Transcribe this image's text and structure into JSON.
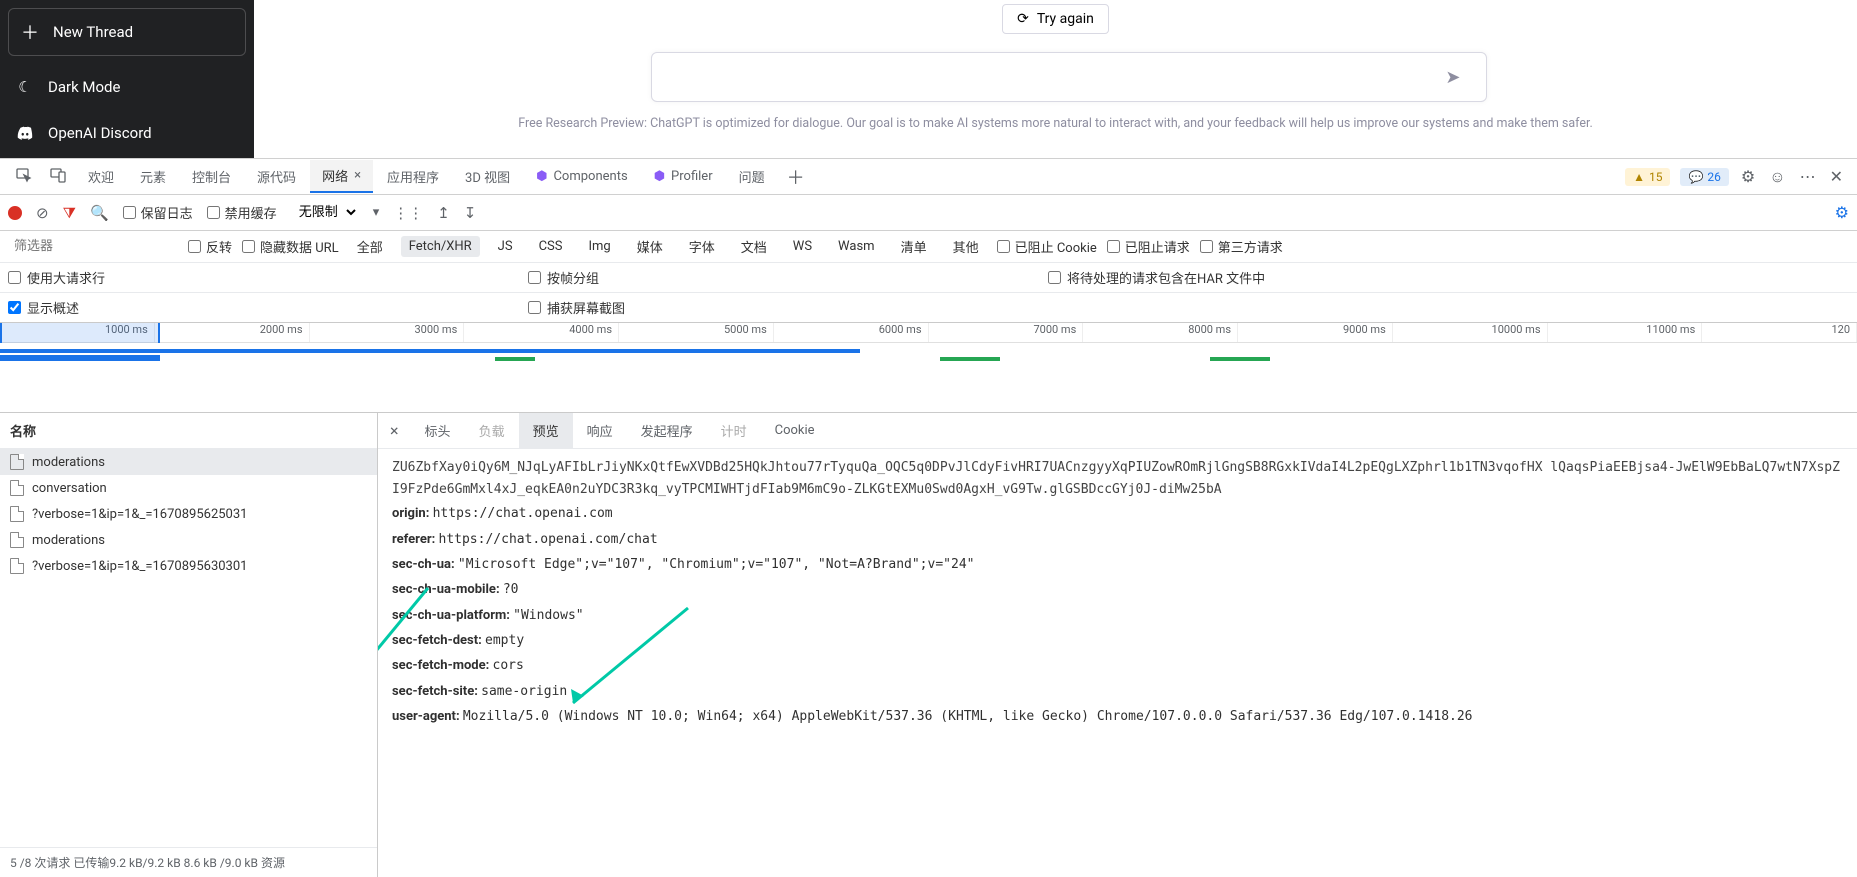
{
  "sidebar": {
    "new_thread": "New Thread",
    "dark_mode": "Dark Mode",
    "discord": "OpenAI Discord"
  },
  "main": {
    "try_again": "Try again",
    "input_placeholder": "",
    "preview_text": "Free Research Preview: ChatGPT is optimized for dialogue. Our goal is to make AI systems more natural to interact with, and your feedback will help us improve our systems and make them safer."
  },
  "devtools": {
    "tabs": {
      "welcome": "欢迎",
      "elements": "元素",
      "console": "控制台",
      "sources": "源代码",
      "network": "网络",
      "application": "应用程序",
      "view3d": "3D 视图",
      "components": "Components",
      "profiler": "Profiler",
      "issues": "问题"
    },
    "badges": {
      "warn": "15",
      "info": "26"
    },
    "toolbar": {
      "preserve_log": "保留日志",
      "disable_cache": "禁用缓存",
      "throttle": "无限制"
    },
    "filters": {
      "placeholder": "筛选器",
      "invert": "反转",
      "hide_data_url": "隐藏数据 URL",
      "all": "全部",
      "fetch_xhr": "Fetch/XHR",
      "js": "JS",
      "css": "CSS",
      "img": "Img",
      "media": "媒体",
      "font": "字体",
      "doc": "文档",
      "ws": "WS",
      "wasm": "Wasm",
      "manifest": "清单",
      "other": "其他",
      "blocked_cookies": "已阻止 Cookie",
      "blocked_requests": "已阻止请求",
      "third_party": "第三方请求"
    },
    "options": {
      "big_rows": "使用大请求行",
      "group_by_frame": "按帧分组",
      "include_har": "将待处理的请求包含在HAR 文件中",
      "show_overview": "显示概述",
      "capture_screenshots": "捕获屏幕截图"
    },
    "timeline_ticks": [
      "1000 ms",
      "2000 ms",
      "3000 ms",
      "4000 ms",
      "5000 ms",
      "6000 ms",
      "7000 ms",
      "8000 ms",
      "9000 ms",
      "10000 ms",
      "11000 ms",
      "120"
    ],
    "requests": {
      "header": "名称",
      "items": [
        "moderations",
        "conversation",
        "?verbose=1&ip=1&_=1670895625031",
        "moderations",
        "?verbose=1&ip=1&_=1670895630301"
      ],
      "footer": "5 /8 次请求   已传输9.2 kB/9.2 kB   8.6 kB /9.0 kB 资源"
    },
    "detail_tabs": {
      "headers": "标头",
      "payload": "负载",
      "preview": "预览",
      "response": "响应",
      "initiator": "发起程序",
      "timing": "计时",
      "cookies": "Cookie"
    },
    "headers": {
      "cookie_blob": "ZU6ZbfXay0iQy6M_NJqLyAFIbLrJiyNKxQtfEwXVDBd25HQkJhtou77rTyquQa_OQC5q0DPvJlCdyFivHRI7UACnzgyyXqPIUZowROmRjlGngSB8RGxkIVdaI4L2pEQgLXZphrl1b1TN3vqofHX lQaqsPiaEEBjsa4-JwElW9EbBaLQ7wtN7XspZI9FzPde6GmMxl4xJ_eqkEA0n2uYDC3R3kq_vyTPCMIWHTjdFIab9M6mC9o-ZLKGtEXMu0Swd0AgxH_vG9Tw.glGSBDccGYj0J-diMw25bA",
      "origin_k": "origin:",
      "origin_v": "https://chat.openai.com",
      "referer_k": "referer:",
      "referer_v": "https://chat.openai.com/chat",
      "secchua_k": "sec-ch-ua:",
      "secchua_v": "\"Microsoft Edge\";v=\"107\", \"Chromium\";v=\"107\", \"Not=A?Brand\";v=\"24\"",
      "secchua_mobile_k": "sec-ch-ua-mobile:",
      "secchua_mobile_v": "?0",
      "secchua_platform_k": "sec-ch-ua-platform:",
      "secchua_platform_v": "\"Windows\"",
      "secfetch_dest_k": "sec-fetch-dest:",
      "secfetch_dest_v": "empty",
      "secfetch_mode_k": "sec-fetch-mode:",
      "secfetch_mode_v": "cors",
      "secfetch_site_k": "sec-fetch-site:",
      "secfetch_site_v": "same-origin",
      "ua_k": "user-agent:",
      "ua_v": "Mozilla/5.0 (Windows NT 10.0; Win64; x64) AppleWebKit/537.36 (KHTML, like Gecko) Chrome/107.0.0.0 Safari/537.36 Edg/107.0.1418.26"
    }
  }
}
